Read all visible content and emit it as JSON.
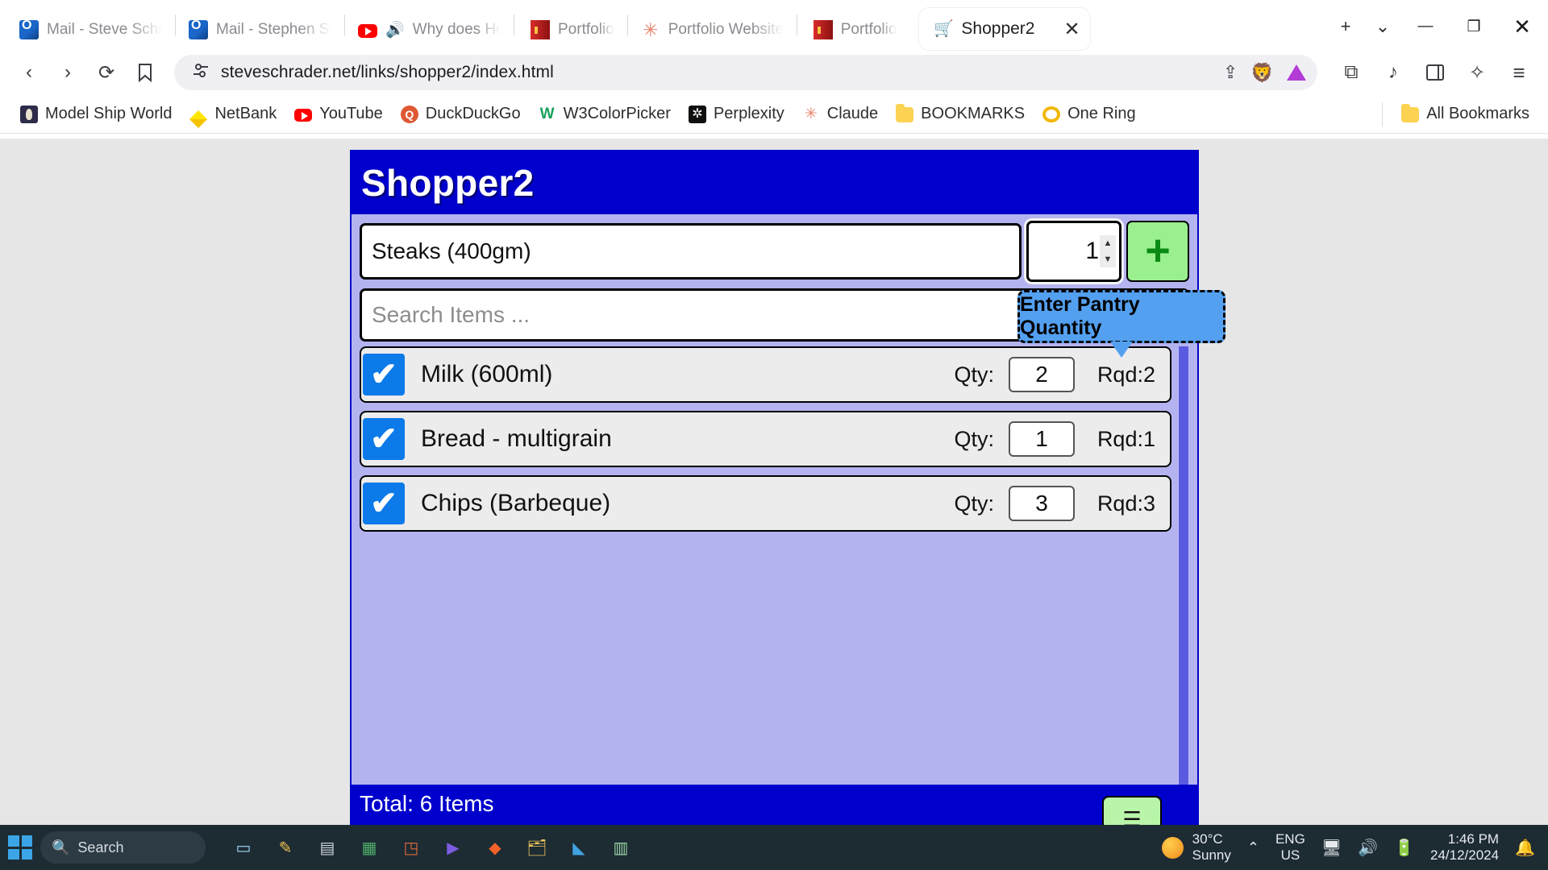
{
  "browser": {
    "tabs": [
      {
        "title": "Mail - Steve Schra",
        "icon": "outlook-icon",
        "active": false
      },
      {
        "title": "Mail - Stephen Sc",
        "icon": "outlook-icon",
        "active": false
      },
      {
        "title": "Why does Ho",
        "icon": "youtube-icon",
        "active": false
      },
      {
        "title": "Portfolio",
        "icon": "book-icon",
        "active": false
      },
      {
        "title": "Portfolio Website",
        "icon": "claude-icon",
        "active": false
      },
      {
        "title": "Portfolio",
        "icon": "book-icon",
        "active": false
      },
      {
        "title": "Shopper2",
        "icon": "shopping-cart-icon",
        "active": true
      }
    ],
    "new_tab_label": "+",
    "tab_search_label": "⌄",
    "minimize_label": "—",
    "maximize_label": "❐",
    "close_label": "✕",
    "nav": {
      "back_label": "‹",
      "forward_label": "›",
      "reload_label": "⟳",
      "bookmark_label": "▯",
      "site_info_label": "site-settings",
      "url": "steveschrader.net/links/shopper2/index.html",
      "share_label": "⇪",
      "shields_label": "brave-shields",
      "leo_label": "leo-ai",
      "extensions_label": "⧉",
      "music_label": "♪",
      "sidebar_label": "▯",
      "rewards_label": "✧",
      "menu_label": "≡"
    },
    "bookmarks": [
      {
        "label": "Model Ship World",
        "icon": "ship-badge-icon"
      },
      {
        "label": "NetBank",
        "icon": "netbank-diamond-icon"
      },
      {
        "label": "YouTube",
        "icon": "youtube-icon"
      },
      {
        "label": "DuckDuckGo",
        "icon": "duckduckgo-icon"
      },
      {
        "label": "W3ColorPicker",
        "icon": "w3schools-icon"
      },
      {
        "label": "Perplexity",
        "icon": "perplexity-icon"
      },
      {
        "label": "Claude",
        "icon": "claude-icon"
      },
      {
        "label": "BOOKMARKS",
        "icon": "folder-icon"
      },
      {
        "label": "One Ring",
        "icon": "ring-icon"
      }
    ],
    "all_bookmarks_label": "All Bookmarks",
    "all_bookmarks_icon": "folder-icon"
  },
  "app": {
    "title": "Shopper2",
    "tooltip": "Enter Pantry Quantity",
    "add_row": {
      "item_value": "Steaks (400gm)",
      "item_placeholder": "",
      "qty_value": "1",
      "spin_up_label": "▲",
      "spin_down_label": "▼",
      "add_button_label": "+"
    },
    "search": {
      "value": "",
      "placeholder": "Search Items ..."
    },
    "list": {
      "qty_label": "Qty:",
      "items": [
        {
          "name": "Milk (600ml)",
          "checked": true,
          "qty": "2",
          "rqd": "Rqd:2"
        },
        {
          "name": "Bread - multigrain",
          "checked": true,
          "qty": "1",
          "rqd": "Rqd:1"
        },
        {
          "name": "Chips (Barbeque)",
          "checked": true,
          "qty": "3",
          "rqd": "Rqd:3"
        }
      ]
    },
    "footer": {
      "total": "Total: 6 Items",
      "action_label": "☰"
    },
    "colors": {
      "header_blue": "#0000cc",
      "body_lavender": "#b3b3f0",
      "add_button_green": "#9af08e",
      "checkbox_blue": "#0c7ae8",
      "tooltip_blue": "#54a0f0"
    }
  },
  "taskbar": {
    "start_label": "start",
    "search_placeholder": "Search",
    "search_icon": "search-icon",
    "apps": [
      {
        "name": "task-view-icon",
        "glyph": "▭"
      },
      {
        "name": "notepad-icon",
        "glyph": "📝"
      },
      {
        "name": "terminal-icon",
        "glyph": "▤"
      },
      {
        "name": "calculator-icon",
        "glyph": "▦"
      },
      {
        "name": "powerpoint-icon",
        "glyph": "◳"
      },
      {
        "name": "media-player-icon",
        "glyph": "▶"
      },
      {
        "name": "brave-icon",
        "glyph": "◆"
      },
      {
        "name": "file-explorer-icon",
        "glyph": "🗂"
      },
      {
        "name": "vscode-icon",
        "glyph": "◣"
      },
      {
        "name": "editor-icon",
        "glyph": "▥"
      }
    ],
    "weather": {
      "temp": "30°C",
      "condition": "Sunny"
    },
    "chevron_label": "⌃",
    "language": {
      "line1": "ENG",
      "line2": "US"
    },
    "tray_icons": [
      "network-icon",
      "volume-icon",
      "battery-icon"
    ],
    "clock": {
      "time": "1:46 PM",
      "date": "24/12/2024"
    },
    "notification_label": "notifications-icon"
  }
}
